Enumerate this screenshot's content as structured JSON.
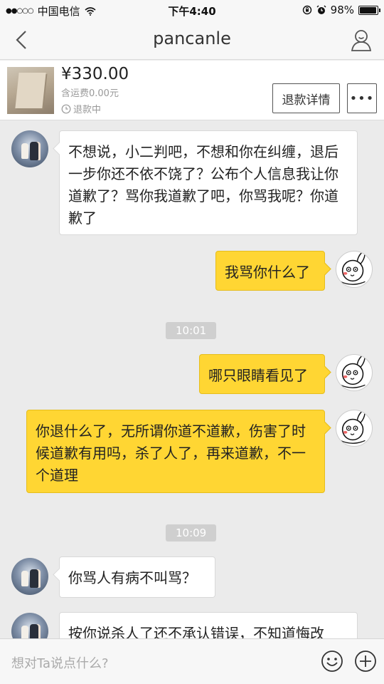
{
  "status_bar": {
    "signal": "●●○○○",
    "carrier": "中国电信",
    "time": "下午4:40",
    "battery_text": "98%",
    "battery_level": 0.98
  },
  "nav": {
    "title": "pancanle",
    "back_icon": "chevron-left-icon",
    "profile_icon": "person-icon"
  },
  "order": {
    "price": "¥330.00",
    "shipping": "含运费0.00元",
    "status": "退款中",
    "refund_button": "退款详情",
    "more_button": "•••"
  },
  "messages": [
    {
      "side": "in",
      "text": "不想说，小二判吧，不想和你在纠缠，退后一步你还不依不饶了？公布个人信息我让你道歉了？骂你我道歉了吧，你骂我呢？你道歉了"
    },
    {
      "side": "out",
      "text": "我骂你什么了"
    },
    {
      "side": "out",
      "text": "哪只眼睛看见了"
    },
    {
      "side": "out",
      "text": "你退什么了，无所谓你道不道歉，伤害了时候道歉有用吗，杀了人了，再来道歉，不一个道理"
    },
    {
      "side": "in",
      "text": "你骂人有病不叫骂？"
    },
    {
      "side": "in",
      "text": "按你说杀人了还不承认错误，不知道悔改"
    }
  ],
  "timestamps": [
    "10:01",
    "10:09"
  ],
  "input": {
    "placeholder": "想对Ta说点什么?"
  },
  "colors": {
    "outgoing_bubble": "#ffd633",
    "incoming_bubble": "#ffffff",
    "background": "#ebebeb"
  }
}
